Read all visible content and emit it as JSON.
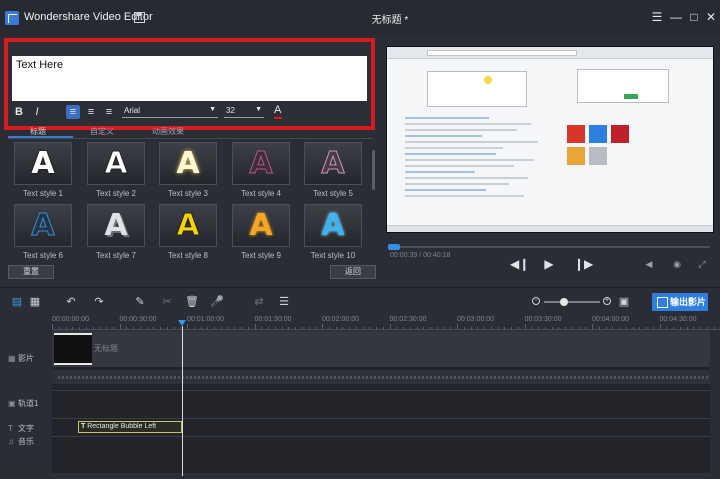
{
  "app": {
    "name": "Wondershare Video Editor",
    "document_title": "无标题 *"
  },
  "text_editor": {
    "text_value": "Text Here",
    "font_name": "Arial",
    "font_size": "32",
    "bold_label": "B",
    "italic_label": "I",
    "color_label": "A",
    "accent_color": "#d71920"
  },
  "tabs": [
    {
      "label": "标题"
    },
    {
      "label": "自定义"
    },
    {
      "label": "动画效果"
    }
  ],
  "styles": [
    {
      "label": "Text style 1",
      "color": "#ffffff"
    },
    {
      "label": "Text style 2",
      "color": "#ffffff"
    },
    {
      "label": "Text style 3",
      "color": "#fff7d6"
    },
    {
      "label": "Text style 4",
      "color": "#3a3036"
    },
    {
      "label": "Text style 5",
      "color": "#4a3a46"
    },
    {
      "label": "Text style 6",
      "color": "#233446"
    },
    {
      "label": "Text style 7",
      "color": "#dfe1e5"
    },
    {
      "label": "Text style 8",
      "color": "#f3d400"
    },
    {
      "label": "Text style 9",
      "color": "#f5a623"
    },
    {
      "label": "Text style 10",
      "color": "#3ab4f2"
    }
  ],
  "buttons": {
    "reset": "重置",
    "back": "返回",
    "export": "输出影片"
  },
  "player": {
    "time": "00:00:39 / 00:40:18",
    "progress": 0.03
  },
  "timeline": {
    "zoom_level": 0.35,
    "ruler": [
      "00:00:00:00",
      "00:00:30:00",
      "00:01:00:00",
      "00:01:30:00",
      "00:02:00:00",
      "00:02:30:00",
      "00:03:00:00",
      "00:03:30:00",
      "00:04:00:00",
      "00:04:30:00"
    ],
    "tracks": {
      "video": "影片",
      "pip": "轨道1",
      "text": "文字",
      "music": "音乐"
    },
    "video_clip_label": "无标题",
    "text_clip_label": "Rectangle Bubble Left"
  }
}
